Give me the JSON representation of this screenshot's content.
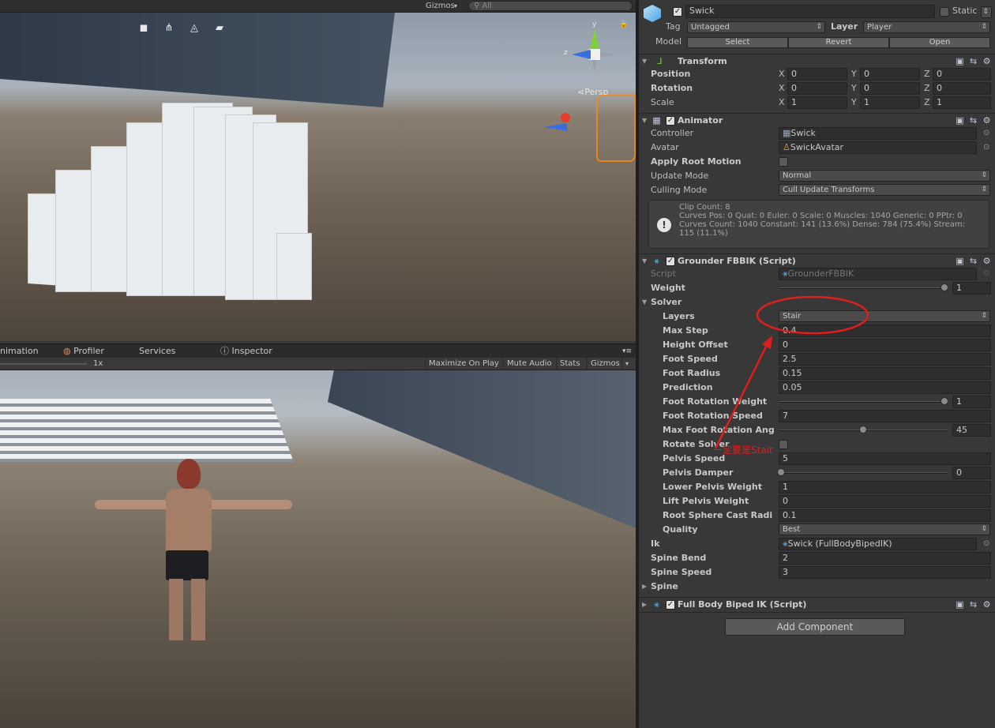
{
  "scene": {
    "gizmos_label": "Gizmos",
    "search_placeholder": "All",
    "persp_label": "Persp",
    "axis_y": "y",
    "axis_z": "z"
  },
  "tabs": {
    "animation": "nimation",
    "profiler": "Profiler",
    "services": "Services",
    "inspector": "Inspector"
  },
  "game_toolbar": {
    "scale": "1x",
    "maximize": "Maximize On Play",
    "mute": "Mute Audio",
    "stats": "Stats",
    "gizmos": "Gizmos"
  },
  "inspector": {
    "object_name": "Swick",
    "static_label": "Static",
    "tag_label": "Tag",
    "tag_value": "Untagged",
    "layer_label": "Layer",
    "layer_value": "Player",
    "model_label": "Model",
    "model_buttons": [
      "Select",
      "Revert",
      "Open"
    ],
    "transform": {
      "title": "Transform",
      "position_label": "Position",
      "rotation_label": "Rotation",
      "scale_label": "Scale",
      "position": [
        "0",
        "0",
        "0"
      ],
      "rotation": [
        "0",
        "0",
        "0"
      ],
      "scale": [
        "1",
        "1",
        "1"
      ],
      "axes": [
        "X",
        "Y",
        "Z"
      ]
    },
    "animator": {
      "title": "Animator",
      "controller_label": "Controller",
      "controller_value": "Swick",
      "avatar_label": "Avatar",
      "avatar_value": "SwickAvatar",
      "apply_root_label": "Apply Root Motion",
      "update_mode_label": "Update Mode",
      "update_mode_value": "Normal",
      "culling_mode_label": "Culling Mode",
      "culling_mode_value": "Cull Update Transforms",
      "info_lines": [
        "Clip Count: 8",
        "Curves Pos: 0 Quat: 0 Euler: 0 Scale: 0 Muscles: 1040 Generic: 0 PPtr: 0",
        "Curves Count: 1040 Constant: 141 (13.6%) Dense: 784 (75.4%) Stream:",
        "115 (11.1%)"
      ]
    },
    "grounder": {
      "title": "Grounder FBBIK (Script)",
      "script_label": "Script",
      "script_value": "GrounderFBBIK",
      "weight_label": "Weight",
      "weight_value": "1",
      "weight_fraction": 1.0,
      "solver_label": "Solver",
      "layers_label": "Layers",
      "layers_value": "Stair",
      "max_step_label": "Max Step",
      "max_step_value": "0.4",
      "height_offset_label": "Height Offset",
      "height_offset_value": "0",
      "foot_speed_label": "Foot Speed",
      "foot_speed_value": "2.5",
      "foot_radius_label": "Foot Radius",
      "foot_radius_value": "0.15",
      "prediction_label": "Prediction",
      "prediction_value": "0.05",
      "foot_rot_weight_label": "Foot Rotation Weight",
      "foot_rot_weight_value": "1",
      "foot_rot_speed_label": "Foot Rotation Speed",
      "foot_rot_speed_value": "7",
      "max_foot_rot_label": "Max Foot Rotation Ang",
      "max_foot_rot_value": "45",
      "max_foot_rot_fraction": 0.5,
      "rotate_solver_label": "Rotate Solver",
      "pelvis_speed_label": "Pelvis Speed",
      "pelvis_speed_value": "5",
      "pelvis_damper_label": "Pelvis Damper",
      "pelvis_damper_value": "0",
      "lower_pelvis_label": "Lower Pelvis Weight",
      "lower_pelvis_value": "1",
      "lift_pelvis_label": "Lift Pelvis Weight",
      "lift_pelvis_value": "0",
      "root_sphere_label": "Root Sphere Cast Radi",
      "root_sphere_value": "0.1",
      "quality_label": "Quality",
      "quality_value": "Best",
      "ik_label": "Ik",
      "ik_value": "Swick (FullBodyBipedIK)",
      "spine_bend_label": "Spine Bend",
      "spine_bend_value": "2",
      "spine_speed_label": "Spine Speed",
      "spine_speed_value": "3",
      "spine_label": "Spine"
    },
    "fbbik": {
      "title": "Full Body Biped IK (Script)"
    },
    "add_component": "Add Component"
  },
  "annotation": {
    "text": "一定要是Stair",
    "color": "#e01e1e"
  }
}
